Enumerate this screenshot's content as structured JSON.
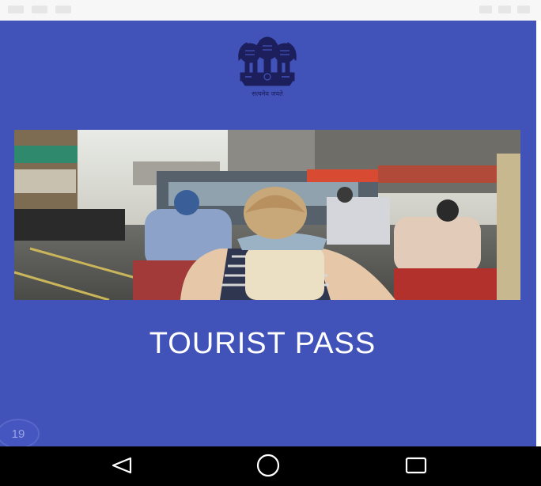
{
  "status_bar": {},
  "header": {
    "emblem_icon": "india-state-emblem-icon",
    "emblem_motto": "सत्यमेव जयते"
  },
  "hero_image": {
    "icon": "street-scene-photo"
  },
  "main": {
    "title": "TOURIST PASS"
  },
  "overlay": {
    "badge_count": "19"
  },
  "nav_bar": {
    "back_icon": "back-triangle-icon",
    "home_icon": "home-circle-icon",
    "recents_icon": "recents-square-icon"
  },
  "colors": {
    "background": "#4152b8",
    "title_text": "#ffffff",
    "nav_bar": "#000000"
  }
}
